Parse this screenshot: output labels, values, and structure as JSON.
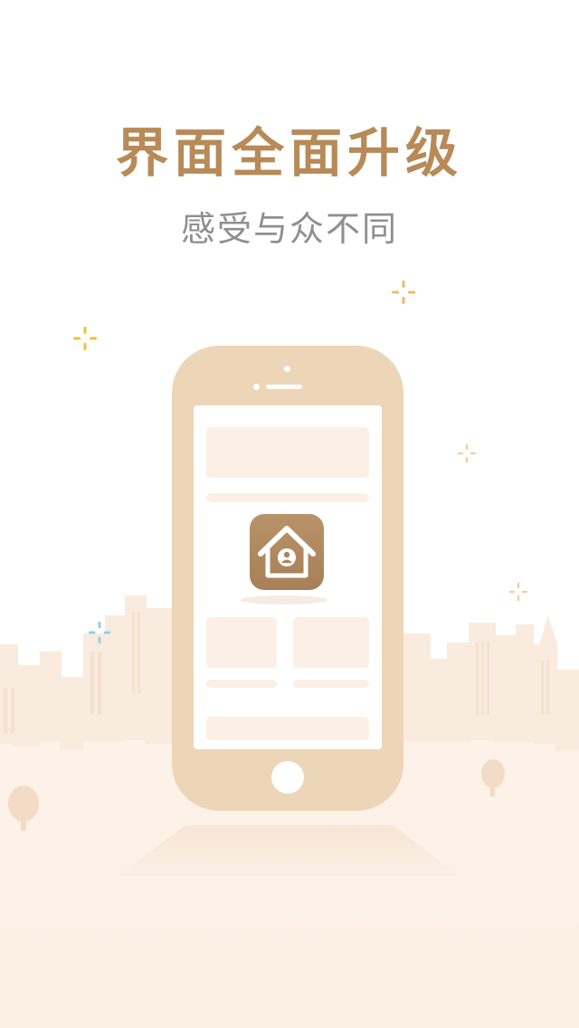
{
  "screen": {
    "headline": "界面全面升级",
    "tagline": "感受与众不同"
  },
  "illustration": {
    "phone_body_color": "#edd5b8",
    "app_icon_color": "#ac845b",
    "placeholder_color": "#fcefe6",
    "icons": [
      "sparkle-icon",
      "house-person-icon",
      "tree-icon",
      "city-skyline"
    ]
  },
  "colors": {
    "headline": "#b78a58",
    "tagline": "#8f8f8f",
    "sparkle_gold": "#f2c12f",
    "sparkle_orange": "#f0b86a",
    "sparkle_blue": "#8ccfe8"
  }
}
